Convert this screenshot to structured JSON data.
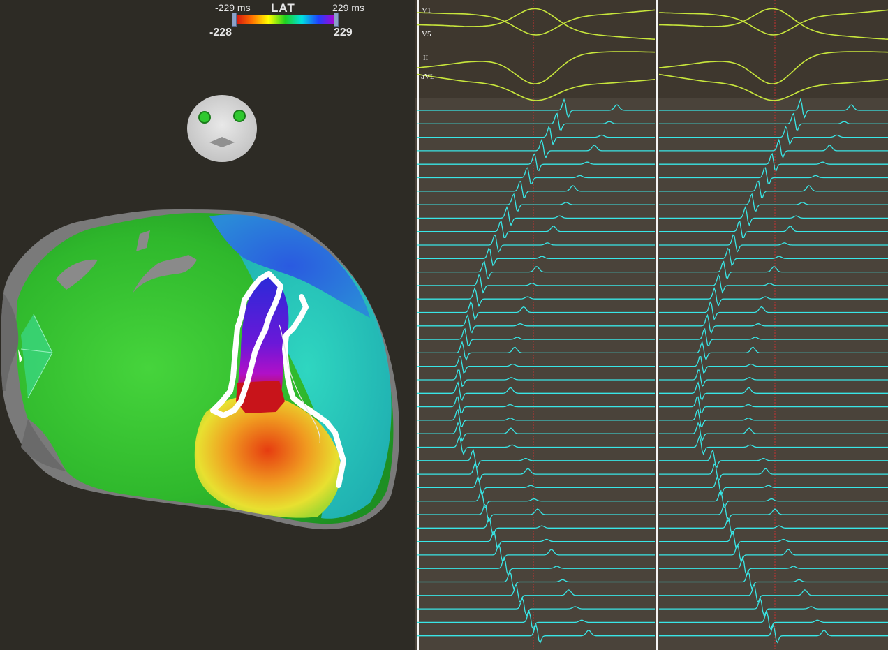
{
  "map": {
    "colorbar": {
      "title": "LAT",
      "min_ms": "-229 ms",
      "max_ms": "229 ms",
      "min_value": "-228",
      "max_value": "229",
      "colors": [
        "#d01010",
        "#ff7000",
        "#ffff00",
        "#20d020",
        "#00e0e0",
        "#2040ff",
        "#b000d0"
      ]
    },
    "icons": [
      "orientation-head-icon",
      "heart-shell-icon"
    ]
  },
  "traces": {
    "surface_leads": [
      "V1",
      "V5",
      "II",
      "aVL"
    ],
    "surface_color": "#c8e63c",
    "intracardiac_color": "#39e6e6",
    "marker_color": "#c83232",
    "channel_count": 40,
    "panels": 2
  }
}
